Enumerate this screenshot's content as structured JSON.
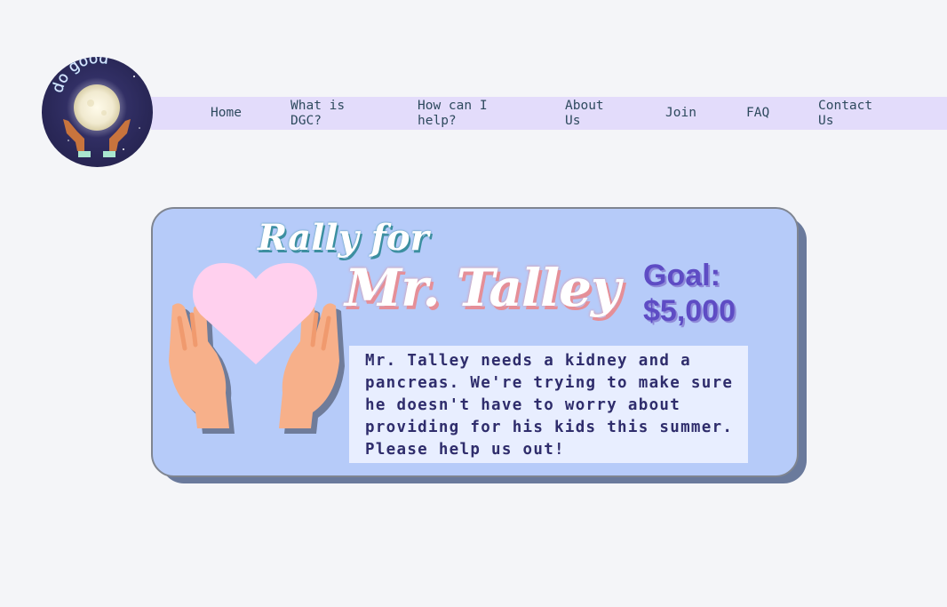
{
  "logo": {
    "text": "do good",
    "icon": "moon-hands-icon"
  },
  "nav": {
    "items": [
      {
        "label": "Home"
      },
      {
        "label": "What is DGC?"
      },
      {
        "label": "How can I help?"
      },
      {
        "label": "About Us"
      },
      {
        "label": "Join"
      },
      {
        "label": "FAQ"
      },
      {
        "label": "Contact Us"
      }
    ]
  },
  "card": {
    "title_line1": "Rally for",
    "title_line2": "Mr. Talley",
    "goal": "Goal: $5,000",
    "description": "Mr. Talley needs a kidney and a pancreas. We're trying to make sure he doesn't have to worry about providing for his kids this summer. Please help us out!",
    "illustration_icon": "heart-in-hands-icon"
  },
  "colors": {
    "background": "#f4f5f8",
    "nav_bar": "#e3dcfb",
    "card_bg": "#b6cbf9",
    "goal_text": "#5e4cc4",
    "heart": "#ffd0ee",
    "hands": "#f7b08a"
  }
}
